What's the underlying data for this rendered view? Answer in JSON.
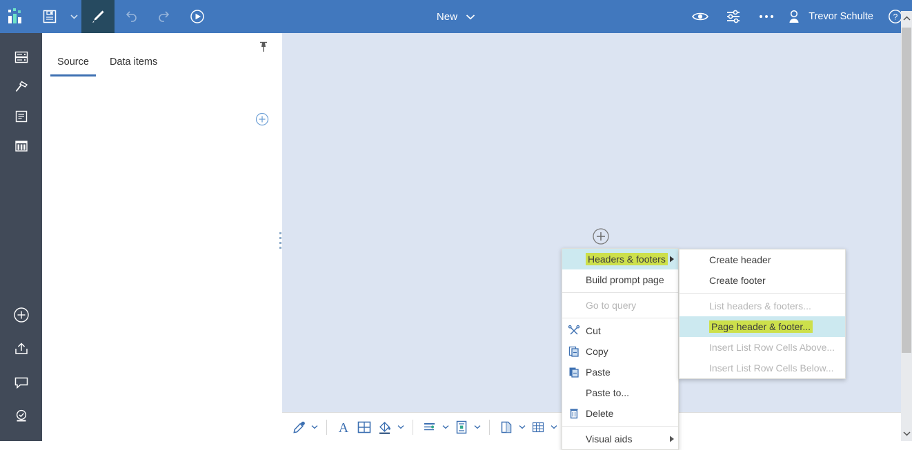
{
  "header": {
    "logo_icon": "cognos-logo-icon",
    "save_label": "save-icon",
    "save_caret": "chevron-down-icon",
    "edit_icon": "pencil-icon",
    "undo_icon": "undo-icon",
    "redo_icon": "redo-icon",
    "run_icon": "play-circle-icon",
    "new_label": "New",
    "new_caret": "chevron-down-icon",
    "preview_icon": "eye-icon",
    "options_icon": "sliders-icon",
    "more_icon": "more-horizontal-icon",
    "avatar_icon": "user-avatar-icon",
    "user_name": "Trevor Schulte",
    "help_icon": "help-circle-icon"
  },
  "rail": {
    "top_items": [
      {
        "name": "sidebar-item-sources",
        "icon": "data-sources-icon"
      },
      {
        "name": "sidebar-item-toolbox",
        "icon": "hammer-icon"
      },
      {
        "name": "sidebar-item-pages",
        "icon": "page-icon"
      },
      {
        "name": "sidebar-item-queries",
        "icon": "table-columns-icon"
      }
    ],
    "bottom_items": [
      {
        "name": "sidebar-item-add",
        "icon": "plus-circle-icon"
      },
      {
        "name": "sidebar-item-upload",
        "icon": "upload-icon"
      },
      {
        "name": "sidebar-item-comments",
        "icon": "comment-icon"
      },
      {
        "name": "sidebar-item-validate",
        "icon": "validate-check-icon"
      }
    ]
  },
  "panel": {
    "pin_icon": "pin-icon",
    "add_icon": "plus-circle-outline-icon",
    "tabs": [
      {
        "label": "Source",
        "active": true
      },
      {
        "label": "Data items",
        "active": false
      }
    ]
  },
  "canvas": {
    "add_icon": "plus-circle-outline-icon"
  },
  "scrollbar": {
    "up_icon": "chevron-up-icon",
    "down_icon": "chevron-down-icon"
  },
  "bottom_toolbar": {
    "items": [
      {
        "name": "eyedropper-tool",
        "icon": "eyedropper-icon",
        "caret": true
      },
      {
        "name": "font-tool",
        "icon": "font-a-icon",
        "caret": false
      },
      {
        "name": "border-tool",
        "icon": "table-border-icon",
        "caret": false
      },
      {
        "name": "fill-color-tool",
        "icon": "paint-bucket-icon",
        "caret": true
      },
      {
        "name": "horizontal-align-tool",
        "icon": "horizontal-align-icon",
        "caret": true
      },
      {
        "name": "vertical-align-tool",
        "icon": "vertical-align-icon",
        "caret": true
      },
      {
        "name": "insert-page-tool",
        "icon": "insert-page-icon",
        "caret": true
      },
      {
        "name": "insert-table-tool",
        "icon": "grid-table-icon",
        "caret": true
      },
      {
        "name": "selection-tool",
        "icon": "marquee-select-icon",
        "caret": true
      }
    ]
  },
  "context_menu": {
    "items": [
      {
        "label": "Headers & footers",
        "icon": null,
        "disabled": false,
        "highlighted": true,
        "submenu": true,
        "separator_after": false
      },
      {
        "label": "Build prompt page",
        "icon": null,
        "disabled": false,
        "highlighted": false,
        "submenu": false,
        "separator_after": true
      },
      {
        "label": "Go to query",
        "icon": null,
        "disabled": true,
        "highlighted": false,
        "submenu": false,
        "separator_after": true
      },
      {
        "label": "Cut",
        "icon": "scissors-icon",
        "disabled": false,
        "highlighted": false,
        "submenu": false,
        "separator_after": false
      },
      {
        "label": "Copy",
        "icon": "copy-icon",
        "disabled": false,
        "highlighted": false,
        "submenu": false,
        "separator_after": false
      },
      {
        "label": "Paste",
        "icon": "paste-icon",
        "disabled": false,
        "highlighted": false,
        "submenu": false,
        "separator_after": false
      },
      {
        "label": "Paste to...",
        "icon": null,
        "disabled": false,
        "highlighted": false,
        "submenu": false,
        "separator_after": false
      },
      {
        "label": "Delete",
        "icon": "trash-icon",
        "disabled": false,
        "highlighted": false,
        "submenu": false,
        "separator_after": true
      },
      {
        "label": "Visual aids",
        "icon": null,
        "disabled": false,
        "highlighted": false,
        "submenu": true,
        "separator_after": false
      }
    ]
  },
  "submenu": {
    "items": [
      {
        "label": "Create header",
        "disabled": false,
        "highlighted": false,
        "separator_after": false
      },
      {
        "label": "Create footer",
        "disabled": false,
        "highlighted": false,
        "separator_after": true
      },
      {
        "label": "List headers & footers...",
        "disabled": true,
        "highlighted": false,
        "separator_after": false
      },
      {
        "label": "Page header & footer...",
        "disabled": true,
        "highlighted": true,
        "separator_after": false
      },
      {
        "label": "Insert List Row Cells Above...",
        "disabled": true,
        "highlighted": false,
        "separator_after": false
      },
      {
        "label": "Insert List Row Cells Below...",
        "disabled": true,
        "highlighted": false,
        "separator_after": false
      }
    ]
  },
  "colors": {
    "header_blue": "#4178be",
    "rail_dark": "#414a58",
    "canvas_blue": "#dce4f2",
    "accent_blue": "#3d70b2",
    "highlight_yellow": "#cde04b",
    "highlight_row": "#cce9f0",
    "icon_blue": "#3d70b2"
  }
}
